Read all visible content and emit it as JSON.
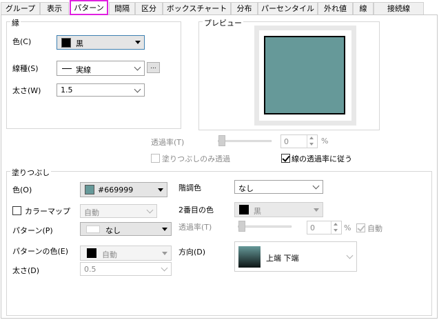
{
  "tabs": [
    {
      "label": "グループ"
    },
    {
      "label": "表示"
    },
    {
      "label": "パターン"
    },
    {
      "label": "間隔"
    },
    {
      "label": "区分"
    },
    {
      "label": "ボックスチャート"
    },
    {
      "label": "分布"
    },
    {
      "label": "パーセンタイル"
    },
    {
      "label": "外れ値"
    },
    {
      "label": "線"
    },
    {
      "label": "接続線"
    }
  ],
  "active_tab": "パターン",
  "border": {
    "group_label": "縁",
    "color_label": "色(C)",
    "color_value": "黒",
    "color_swatch": "#000000",
    "linetype_label": "線種(S)",
    "linetype_value": "実線",
    "linetype_more": "...",
    "width_label": "太さ(W)",
    "width_value": "1.5"
  },
  "preview": {
    "group_label": "プレビュー",
    "fill_color": "#669999",
    "border_color": "#000000"
  },
  "transparency": {
    "label": "透過率(T)",
    "value": "0",
    "unit": "%",
    "level": 0,
    "fill_only_label": "塗りつぶしのみ透過",
    "fill_only_checked": false,
    "follow_line_label": "線の透過率に従う",
    "follow_line_checked": true
  },
  "fill": {
    "group_label": "塗りつぶし",
    "color_label": "色(O)",
    "color_value": "#669999",
    "color_swatch": "#669999",
    "colormap_label": "カラーマップ",
    "colormap_checked": false,
    "colormap_value": "自動",
    "pattern_label": "パターン(P)",
    "pattern_value": "なし",
    "pattern_color_label": "パターンの色(E)",
    "pattern_color_value": "自動",
    "pattern_color_swatch": "#000000",
    "pattern_width_label": "太さ(D)",
    "pattern_width_value": "0.5",
    "gradient_label": "階調色",
    "gradient_value": "なし",
    "second_color_label": "2番目の色",
    "second_color_value": "黒",
    "second_color_swatch": "#000000",
    "transparency_label": "透過率(T)",
    "transparency_value": "0",
    "transparency_unit": "%",
    "transparency_level": 0,
    "auto_label": "自動",
    "auto_checked": true,
    "direction_label": "方向(D)",
    "direction_value": "上端 下端"
  },
  "colors": {
    "tab_highlight": "#e020e0",
    "preview_fill": "#669999"
  }
}
